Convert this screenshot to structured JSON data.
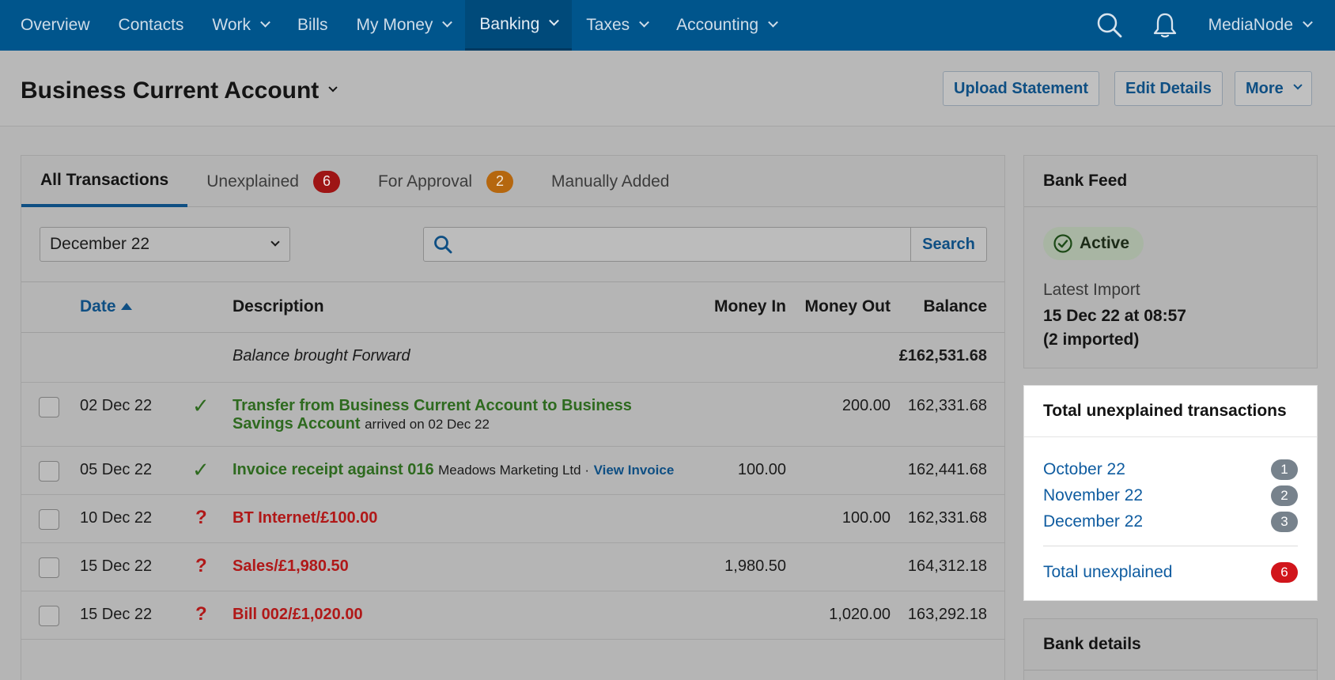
{
  "nav": {
    "items": [
      {
        "label": "Overview",
        "dropdown": false,
        "active": false
      },
      {
        "label": "Contacts",
        "dropdown": false,
        "active": false
      },
      {
        "label": "Work",
        "dropdown": true,
        "active": false
      },
      {
        "label": "Bills",
        "dropdown": false,
        "active": false
      },
      {
        "label": "My Money",
        "dropdown": true,
        "active": false
      },
      {
        "label": "Banking",
        "dropdown": true,
        "active": true
      },
      {
        "label": "Taxes",
        "dropdown": true,
        "active": false
      },
      {
        "label": "Accounting",
        "dropdown": true,
        "active": false
      }
    ],
    "user": "MediaNode",
    "icons": [
      "search-icon",
      "bell-icon"
    ]
  },
  "header": {
    "title": "Business Current Account",
    "buttons": {
      "upload": "Upload Statement",
      "edit": "Edit Details",
      "more": "More"
    }
  },
  "tabs": {
    "all": "All Transactions",
    "unexplained": "Unexplained",
    "unexplained_count": "6",
    "approval": "For Approval",
    "approval_count": "2",
    "manual": "Manually Added"
  },
  "filters": {
    "month": "December 22",
    "search_placeholder": "",
    "search_button": "Search"
  },
  "table": {
    "headers": {
      "date": "Date",
      "description": "Description",
      "money_in": "Money In",
      "money_out": "Money Out",
      "balance": "Balance"
    },
    "brought_forward": {
      "label": "Balance brought Forward",
      "balance": "£162,531.68"
    },
    "rows": [
      {
        "date": "02 Dec 22",
        "status": "explained",
        "title": "Transfer from Business Current Account to Business Savings Account",
        "detail": "arrived on 02 Dec 22",
        "link": "",
        "money_in": "",
        "money_out": "200.00",
        "balance": "162,331.68"
      },
      {
        "date": "05 Dec 22",
        "status": "explained",
        "title": "Invoice receipt against 016",
        "detail": "Meadows Marketing Ltd ·",
        "link": "View Invoice",
        "money_in": "100.00",
        "money_out": "",
        "balance": "162,441.68"
      },
      {
        "date": "10 Dec 22",
        "status": "unexplained",
        "title": "BT Internet/£100.00",
        "detail": "",
        "link": "",
        "money_in": "",
        "money_out": "100.00",
        "balance": "162,331.68"
      },
      {
        "date": "15 Dec 22",
        "status": "unexplained",
        "title": "Sales/£1,980.50",
        "detail": "",
        "link": "",
        "money_in": "1,980.50",
        "money_out": "",
        "balance": "164,312.18"
      },
      {
        "date": "15 Dec 22",
        "status": "unexplained",
        "title": "Bill 002/£1,020.00",
        "detail": "",
        "link": "",
        "money_in": "",
        "money_out": "1,020.00",
        "balance": "163,292.18"
      }
    ]
  },
  "bank_feed": {
    "title": "Bank Feed",
    "status": "Active",
    "latest_label": "Latest Import",
    "latest_value": "15 Dec 22 at 08:57",
    "imported": "(2 imported)"
  },
  "unexplained_panel": {
    "title": "Total unexplained transactions",
    "months": [
      {
        "label": "October 22",
        "count": "1"
      },
      {
        "label": "November 22",
        "count": "2"
      },
      {
        "label": "December 22",
        "count": "3"
      }
    ],
    "total_label": "Total unexplained",
    "total_count": "6"
  },
  "bank_details": {
    "title": "Bank details"
  },
  "colors": {
    "nav": "#00558c",
    "link": "#0f4f83",
    "explained": "#2e6a1f",
    "unexplained": "#b01818"
  }
}
